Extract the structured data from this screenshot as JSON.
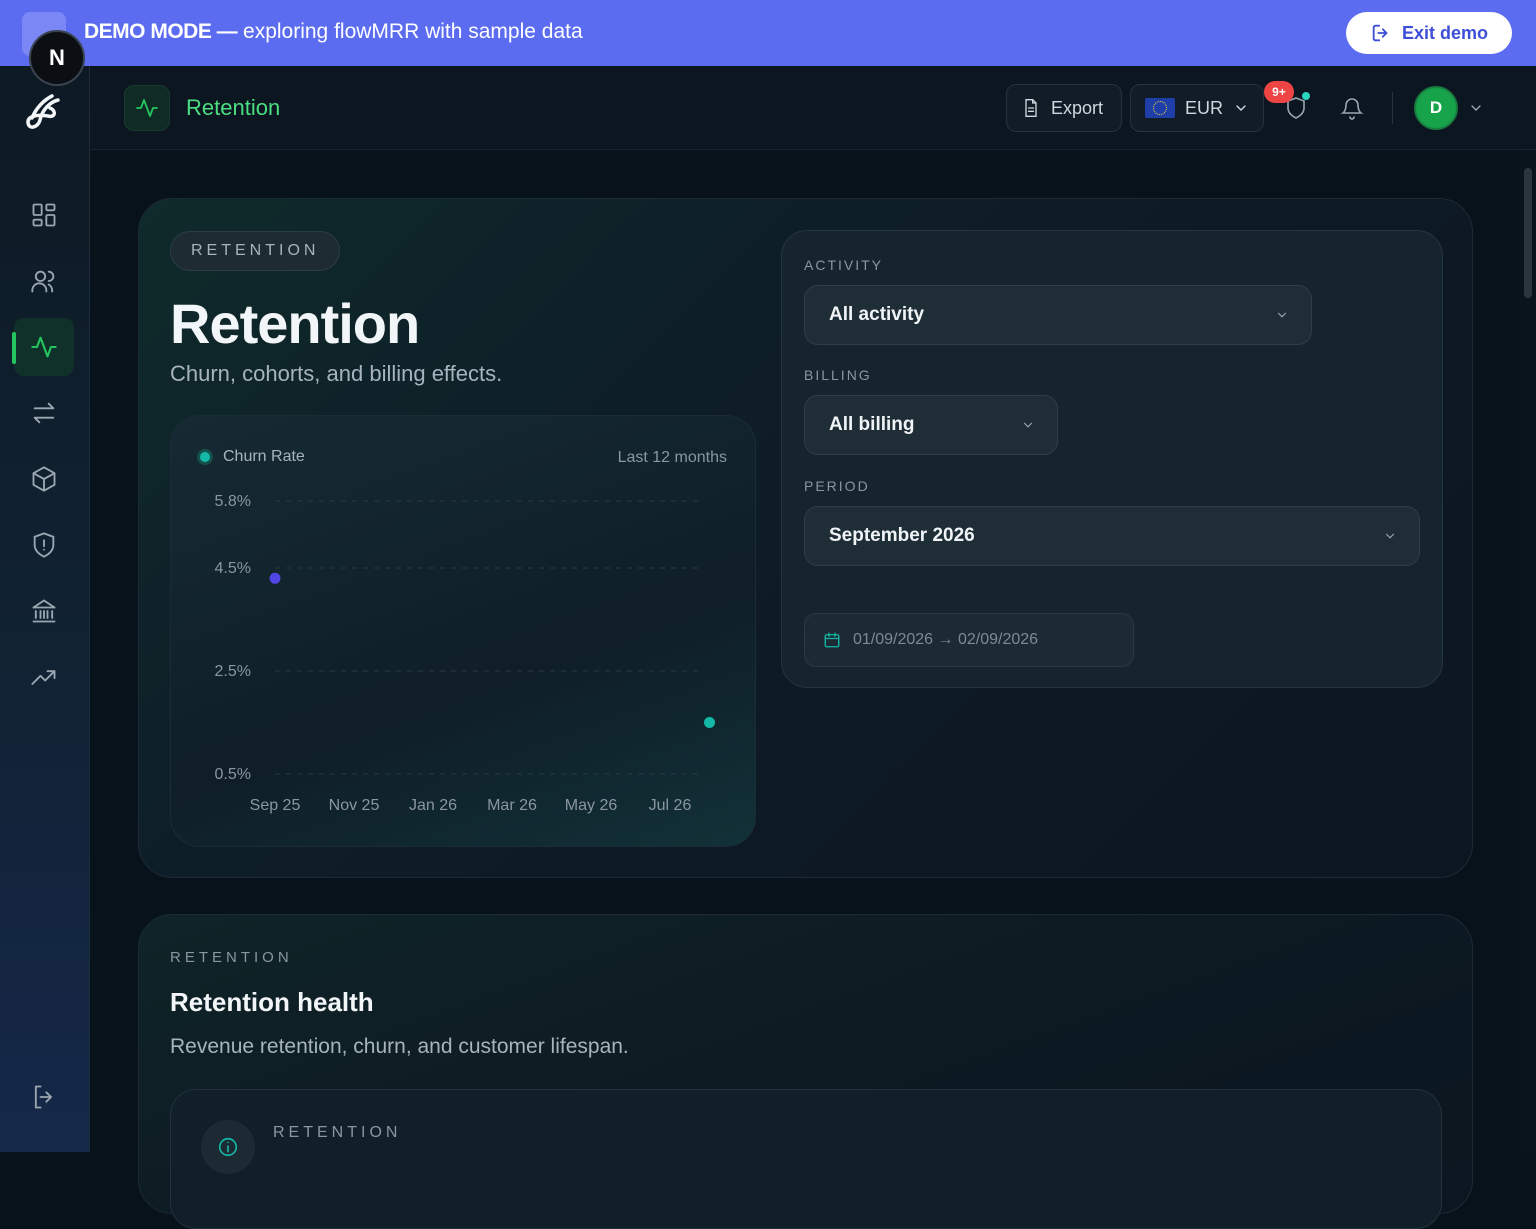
{
  "banner": {
    "mode_label": "DEMO MODE —",
    "message": "exploring flowMRR with sample data",
    "exit_label": "Exit demo"
  },
  "badge": {
    "letter": "N"
  },
  "topbar": {
    "page_title": "Retention",
    "export_label": "Export",
    "currency": "EUR",
    "notification_count": "9+",
    "avatar_initial": "D"
  },
  "sidebar": {
    "items": [
      {
        "name": "dashboard",
        "icon": "grid-icon"
      },
      {
        "name": "customers",
        "icon": "users-icon"
      },
      {
        "name": "retention",
        "icon": "activity-icon",
        "active": true
      },
      {
        "name": "transactions",
        "icon": "arrows-icon"
      },
      {
        "name": "products",
        "icon": "box-icon"
      },
      {
        "name": "risk",
        "icon": "shield-alert-icon"
      },
      {
        "name": "banking",
        "icon": "bank-icon"
      },
      {
        "name": "growth",
        "icon": "trending-up-icon"
      }
    ],
    "logout_icon": "logout-icon"
  },
  "hero": {
    "pill": "RETENTION",
    "title": "Retention",
    "subtitle": "Churn, cohorts, and billing effects.",
    "chart_range_label": "Last 12 months"
  },
  "filters": {
    "activity_label": "ACTIVITY",
    "activity_value": "All activity",
    "billing_label": "BILLING",
    "billing_value": "All billing",
    "period_label": "PERIOD",
    "period_value": "September 2026",
    "date_range": "01/09/2026 → 02/09/2026"
  },
  "health": {
    "eyebrow": "RETENTION",
    "title": "Retention health",
    "subtitle": "Revenue retention, churn, and customer lifespan.",
    "inner_label": "RETENTION"
  },
  "chart_data": {
    "type": "scatter",
    "title": "",
    "series": [
      {
        "name": "Churn Rate",
        "color": "#14b8a6"
      }
    ],
    "x_tick_labels": [
      "Sep 25",
      "Nov 25",
      "Jan 26",
      "Mar 26",
      "May 26",
      "Jul 26"
    ],
    "y_tick_labels": [
      "5.8%",
      "4.5%",
      "2.5%",
      "0.5%"
    ],
    "y_ticks": [
      5.8,
      4.5,
      2.5,
      0.5
    ],
    "points": [
      {
        "x": "Sep 25",
        "y": 4.3,
        "color": "#4f46e5"
      },
      {
        "x": "Aug 26",
        "y": 1.5,
        "color": "#14b8a6"
      }
    ],
    "xlabel": "",
    "ylabel": "",
    "grid": true
  },
  "colors": {
    "banner": "#5b6cf0",
    "accent_green": "#22c55e",
    "accent_teal": "#14b8a6",
    "point_indigo": "#4f46e5",
    "badge_red": "#ef4444"
  }
}
